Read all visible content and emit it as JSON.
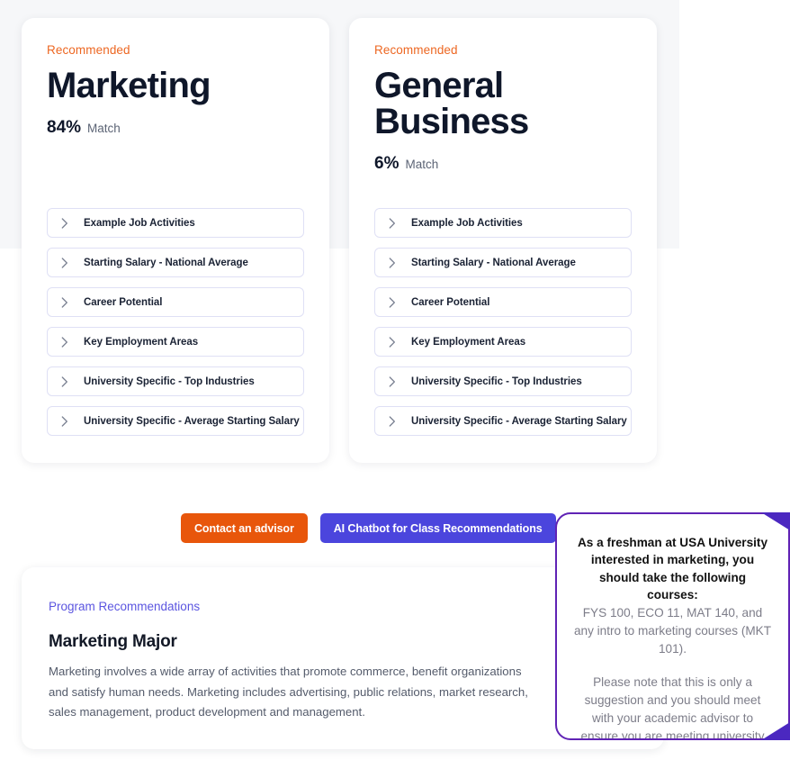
{
  "cards": [
    {
      "badge": "Recommended",
      "title": "Marketing",
      "match_pct": "84%",
      "match_word": "Match",
      "accordion": [
        "Example Job Activities",
        "Starting Salary - National Average",
        "Career Potential",
        "Key Employment Areas",
        "University Specific - Top Industries",
        "University Specific - Average Starting Salary"
      ]
    },
    {
      "badge": "Recommended",
      "title": "General Business",
      "match_pct": "6%",
      "match_word": "Match",
      "accordion": [
        "Example Job Activities",
        "Starting Salary - National Average",
        "Career Potential",
        "Key Employment Areas",
        "University Specific - Top Industries",
        "University Specific - Average Starting Salary"
      ]
    }
  ],
  "actions": {
    "advisor_label": "Contact an advisor",
    "chatbot_label": "AI Chatbot for Class Recommendations",
    "advisor_color": "#e8560b",
    "chatbot_color": "#4b45dd"
  },
  "program": {
    "kicker": "Program Recommendations",
    "title": "Marketing Major",
    "body": "Marketing involves a wide array of activities that promote commerce, benefit organizations and satisfy human needs. Marketing includes advertising, public relations, market research, sales management, product development and management."
  },
  "chat_bubble": {
    "question": "As a freshman at USA University interested in marketing, you should take the following courses:",
    "answer_1": "FYS 100, ECO 11, MAT 140, and any intro to marketing courses (MKT 101).",
    "answer_2": "Please note that this is only a suggestion and you should meet with your academic advisor to ensure you are meeting university guidelines.",
    "border_color": "#6023b5",
    "tail_color": "#4b28c0"
  },
  "icons": {
    "chevron": "chevron-right-icon"
  }
}
